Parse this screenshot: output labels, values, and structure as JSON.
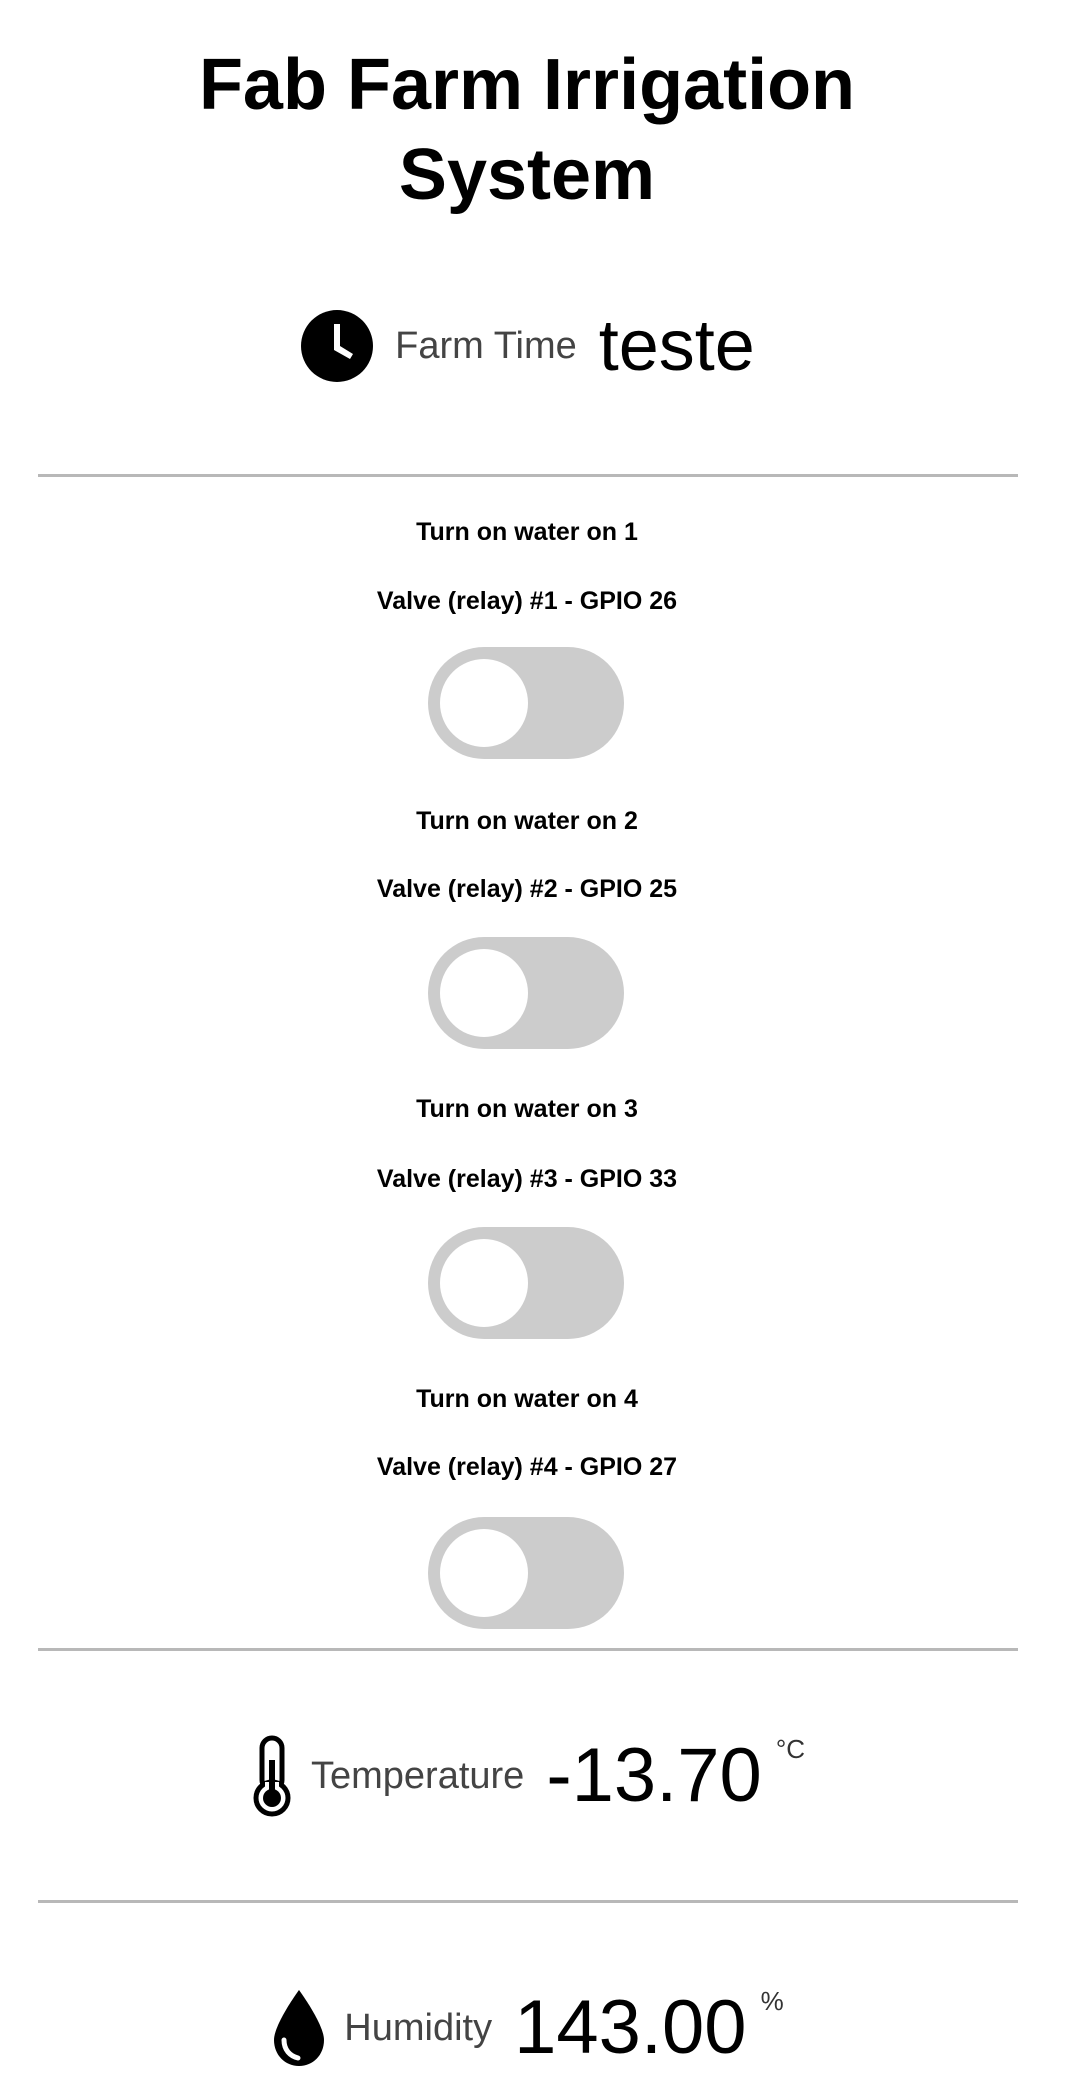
{
  "header": {
    "title_line1": "Fab Farm Irrigation",
    "title_line2": "System"
  },
  "time": {
    "icon": "clock-icon",
    "label": "Farm Time",
    "value": "teste"
  },
  "valves": [
    {
      "heading": "Turn on water on 1",
      "subtitle": "Valve (relay) #1 - GPIO 26",
      "on": false
    },
    {
      "heading": "Turn on water on 2",
      "subtitle": "Valve (relay) #2 - GPIO 25",
      "on": false
    },
    {
      "heading": "Turn on water on 3",
      "subtitle": "Valve (relay) #3 - GPIO 33",
      "on": false
    },
    {
      "heading": "Turn on water on 4",
      "subtitle": "Valve (relay) #4 - GPIO 27",
      "on": false
    }
  ],
  "temperature": {
    "icon": "thermometer-icon",
    "label": "Temperature",
    "value": "-13.70",
    "unit": "°C"
  },
  "humidity": {
    "icon": "water-drop-icon",
    "label": "Humidity",
    "value": "143.00",
    "unit": "%"
  },
  "colors": {
    "switch_off": "#cccccc",
    "divider": "#b8b8b8"
  }
}
